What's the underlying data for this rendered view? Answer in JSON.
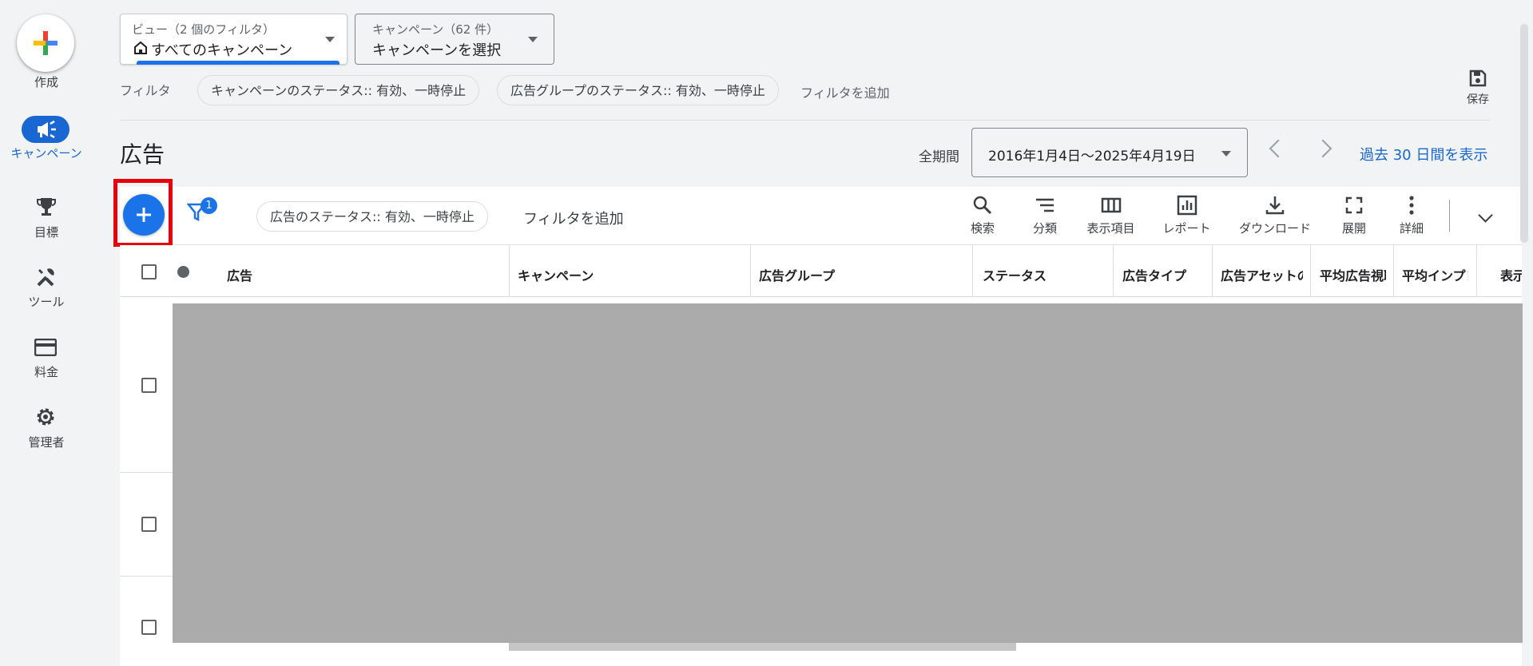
{
  "rail": {
    "create_label": "作成",
    "items": [
      {
        "label": "キャンペーン",
        "icon": "megaphone-icon",
        "active": true
      },
      {
        "label": "目標",
        "icon": "trophy-icon"
      },
      {
        "label": "ツール",
        "icon": "tools-icon"
      },
      {
        "label": "料金",
        "icon": "credit-card-icon"
      },
      {
        "label": "管理者",
        "icon": "gear-icon"
      }
    ]
  },
  "top": {
    "view_small": "ビュー（2 個のフィルタ）",
    "view_value": "すべてのキャンペーン",
    "campaign_small": "キャンペーン（62 件）",
    "campaign_value": "キャンペーンを選択",
    "filter_label": "フィルタ",
    "chips": [
      "キャンペーンのステータス:: 有効、一時停止",
      "広告グループのステータス:: 有効、一時停止"
    ],
    "add_filter": "フィルタを追加",
    "save_label": "保存"
  },
  "header": {
    "title": "広告",
    "period_label": "全期間",
    "date_range": "2016年1月4日〜2025年4月19日",
    "last30": "過去 30 日間を表示"
  },
  "toolbar": {
    "filter_badge": "1",
    "status_chip": "広告のステータス:: 有効、一時停止",
    "add_filter": "フィルタを追加",
    "tools": [
      {
        "label": "検索",
        "icon": "search-icon"
      },
      {
        "label": "分類",
        "icon": "segment-icon"
      },
      {
        "label": "表示項目",
        "icon": "columns-icon"
      },
      {
        "label": "レポート",
        "icon": "report-icon"
      },
      {
        "label": "ダウンロード",
        "icon": "download-icon"
      },
      {
        "label": "展開",
        "icon": "expand-icon"
      },
      {
        "label": "詳細",
        "icon": "more-vert-icon"
      }
    ]
  },
  "table": {
    "columns": [
      "広告",
      "キャンペーン",
      "広告グループ",
      "ステータス",
      "広告タイプ",
      "広告アセットの",
      "平均広告視聴",
      "平均インプレ",
      "表示"
    ]
  },
  "colors": {
    "accent": "#1a73e8",
    "highlight": "#e8000b",
    "redaction": "#ababab"
  }
}
